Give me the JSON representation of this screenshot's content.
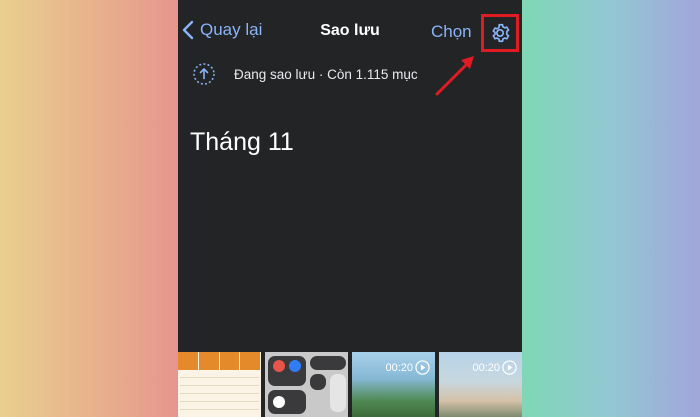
{
  "nav": {
    "back_label": "Quay lại",
    "title": "Sao lưu",
    "select_label": "Chọn",
    "settings_icon": "gear-icon"
  },
  "backup_status": {
    "icon": "backup-upload-icon",
    "text": "Đang sao lưu · Còn 1.115 mục"
  },
  "section": {
    "month_heading": "Tháng 11"
  },
  "thumbnails": [
    {
      "kind": "image",
      "description_icon": "spreadsheet-thumbnail"
    },
    {
      "kind": "image",
      "description_icon": "control-center-thumbnail"
    },
    {
      "kind": "video",
      "duration": "00:20"
    },
    {
      "kind": "video",
      "duration": "00:20"
    }
  ],
  "colors": {
    "accent": "#8ab4f8",
    "highlight_box": "#e11b22",
    "background": "#232426"
  }
}
